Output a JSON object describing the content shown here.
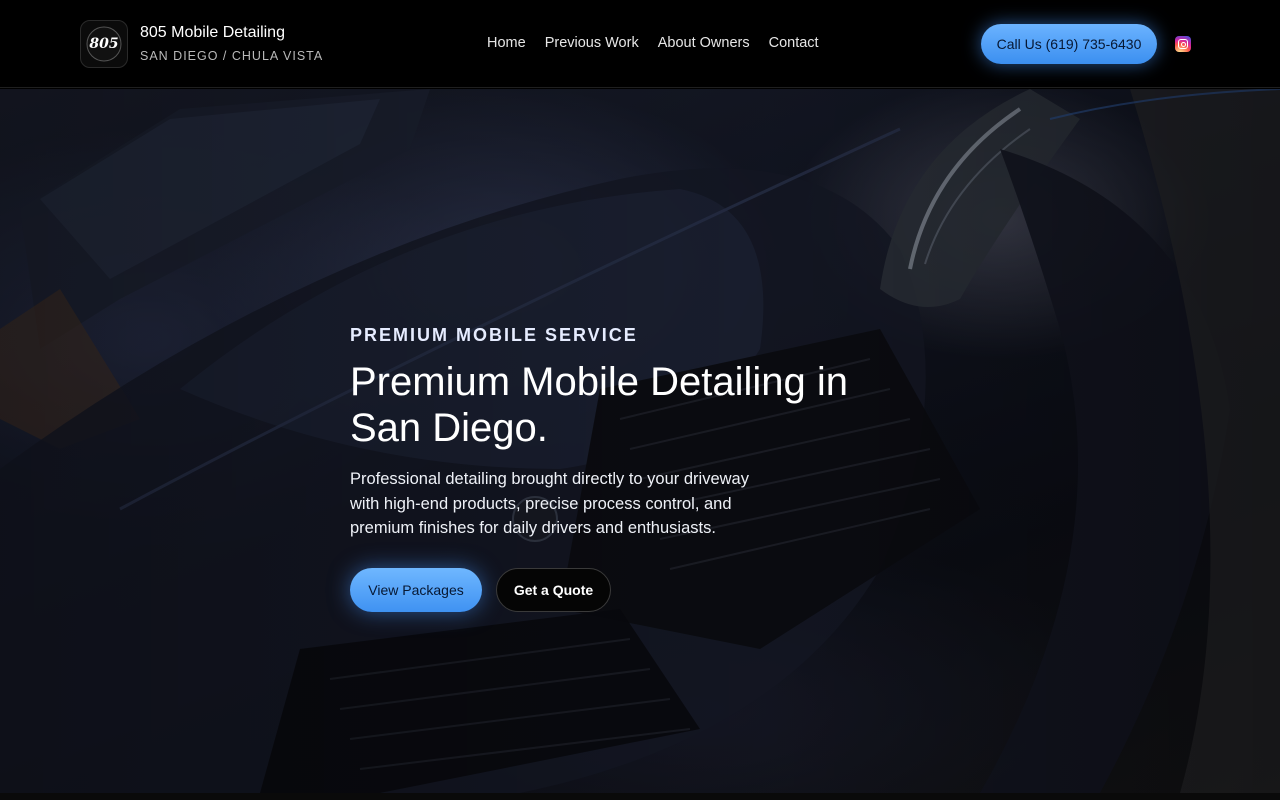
{
  "brand": {
    "logo_text": "805",
    "name": "805 Mobile Detailing",
    "subtitle": "SAN DIEGO / CHULA VISTA"
  },
  "nav": {
    "items": [
      {
        "label": "Home"
      },
      {
        "label": "Previous Work"
      },
      {
        "label": "About Owners"
      },
      {
        "label": "Contact"
      }
    ]
  },
  "header": {
    "call_label": "Call Us (619) 735-6430",
    "social_icon": "instagram-icon"
  },
  "hero": {
    "eyebrow": "PREMIUM MOBILE SERVICE",
    "title": "Premium Mobile Detailing in San Diego.",
    "description": "Professional detailing brought directly to your driveway with high-end products, precise process control, and premium finishes for daily drivers and enthusiasts.",
    "primary_cta": "View Packages",
    "secondary_cta": "Get a Quote"
  },
  "colors": {
    "accent": "#4a9bf5",
    "background": "#000000",
    "text": "#ffffff"
  }
}
